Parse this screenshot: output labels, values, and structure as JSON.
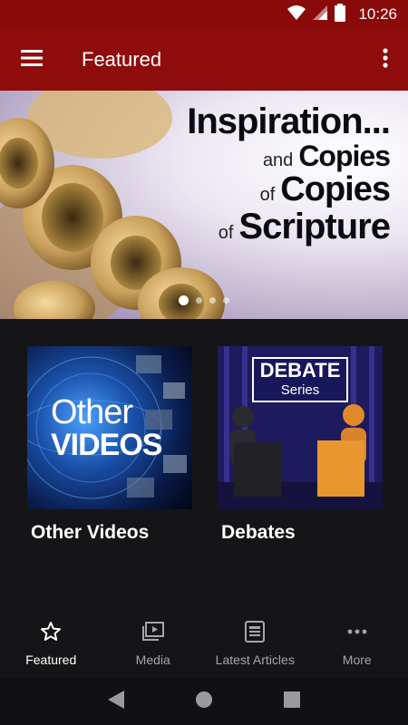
{
  "status": {
    "time": "10:26"
  },
  "appbar": {
    "title": "Featured"
  },
  "hero": {
    "line1": "Inspiration...",
    "line2_small": "and",
    "line2_big": "Copies",
    "line3_small": "of",
    "line3_big": "Copies",
    "line4_small": "of",
    "line4_big": "Scripture",
    "active_slide": 1,
    "slide_count": 4
  },
  "cards": [
    {
      "label": "Other Videos",
      "art_line1": "Other",
      "art_line2": "VIDEOS"
    },
    {
      "label": "Debates",
      "art_line1": "DEBATE",
      "art_line2": "Series"
    }
  ],
  "bottom_nav": [
    {
      "label": "Featured",
      "icon": "star-icon",
      "active": true
    },
    {
      "label": "Media",
      "icon": "media-icon",
      "active": false
    },
    {
      "label": "Latest Articles",
      "icon": "articles-icon",
      "active": false
    },
    {
      "label": "More",
      "icon": "more-horizontal-icon",
      "active": false
    }
  ],
  "colors": {
    "appbar": "#8f0c0c",
    "background": "#151518",
    "nav_inactive": "#a6a6a8"
  }
}
